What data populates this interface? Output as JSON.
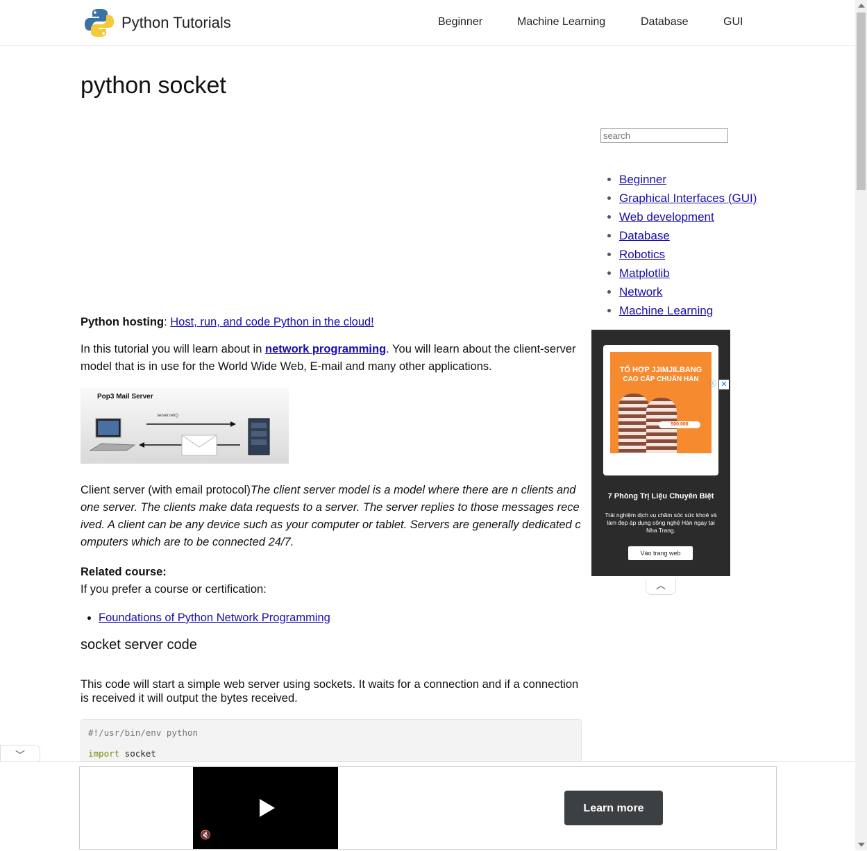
{
  "header": {
    "site_title": "Python Tutorials",
    "nav": [
      "Beginner",
      "Machine Learning",
      "Database",
      "GUI"
    ]
  },
  "page": {
    "title": "python socket"
  },
  "article": {
    "hosting_label": "Python hosting",
    "hosting_sep": ": ",
    "hosting_link": "Host, run, and code Python in the cloud!",
    "intro_before": "In this tutorial you will learn about in ",
    "intro_link": "network programming",
    "intro_after": ". You will learn about the client-server model that is in use for the World Wide Web, E-mail and many other applications.",
    "diagram_title": "Pop3 Mail Server",
    "diagram_arrow_label": "server.retr()",
    "client_caption": "Client server (with email protocol)",
    "client_desc": "The client server model is a model where there are n clients and one server. The clients make data requests to a server. The server replies to those messages received. A client can be any device such as your computer or tablet. Servers are generally dedicated computers which are to be connected 24/7.",
    "related_heading": "Related course:",
    "related_text": "If you prefer a course or certification:",
    "course_link": "Foundations of Python Network Programming",
    "section_heading": "socket server code",
    "code_intro": "This code will start a simple web server using sockets. It waits for a connection and if a connection is received it will output the bytes received.",
    "code_line1": "#!/usr/bin/env python",
    "code_kw": "import",
    "code_mod": " socket"
  },
  "sidebar": {
    "search_placeholder": "search",
    "links": [
      "Beginner",
      "Graphical Interfaces (GUI)",
      "Web development",
      "Database",
      "Robotics",
      "Matplotlib",
      "Network",
      "Machine Learning"
    ]
  },
  "right_ad": {
    "poster_title": "TỔ HỢP JJIMJILBANG",
    "poster_sub": "CAO CẤP CHUẨN HÀN",
    "poster_price": "500.000",
    "headline": "7 Phòng Trị Liệu Chuyên Biệt",
    "body": "Trải nghiệm dịch vụ chăm sóc sức khoẻ và làm đẹp áp dụng công nghệ Hàn ngay tại Nha Trang.",
    "cta": "Vào trang web",
    "close_glyph": "✕",
    "info_glyph": "ⓘ"
  },
  "bottom_ad": {
    "cta": "Learn more"
  },
  "icons": {
    "collapse": "︿",
    "expand": "﹀",
    "mute": "🔇"
  },
  "colors": {
    "link": "#1a0dab",
    "ad_orange": "#f58a2e",
    "learn_more_bg": "#3c4043"
  }
}
